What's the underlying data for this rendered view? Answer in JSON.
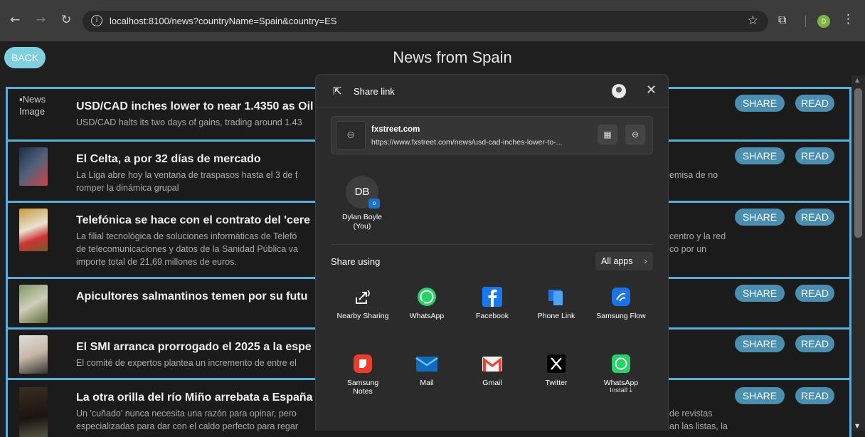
{
  "browser": {
    "url": "localhost:8100/news?countryName=Spain&country=ES",
    "profile_initial": "D"
  },
  "header": {
    "back_label": "BACK",
    "title": "News from Spain"
  },
  "news": [
    {
      "title": "USD/CAD inches lower to near 1.4350 as Oil",
      "desc": "USD/CAD halts its two days of gains, trading around 1.43",
      "desc_right": "",
      "image_alt": "News Image",
      "share_label": "SHARE",
      "read_label": "READ"
    },
    {
      "title": "El Celta, a por 32 días de mercado",
      "desc": "La Liga abre hoy la ventana de traspasos hasta el 3 de f",
      "desc_line2": "romper la dinámica grupal",
      "desc_right": "emisa de no",
      "share_label": "SHARE",
      "read_label": "READ"
    },
    {
      "title": "Telefónica se hace con el contrato del 'cere",
      "desc": "La filial tecnológica de soluciones informáticas de Telefó",
      "desc_line2": "de telecomunicaciones y datos de la Sanidad Pública va",
      "desc_line3": "importe total de 21,69 millones de euros.",
      "desc_right": "centro y la red",
      "desc_right2": "co por un",
      "share_label": "SHARE",
      "read_label": "READ"
    },
    {
      "title": "Apicultores salmantinos temen por su futu",
      "desc": "",
      "share_label": "SHARE",
      "read_label": "READ"
    },
    {
      "title": "El SMI arranca prorrogado el 2025 a la espe",
      "desc": "El comité de expertos plantea un incremento de entre el",
      "share_label": "SHARE",
      "read_label": "READ"
    },
    {
      "title": "La otra orilla del río Miño arrebata a España",
      "desc": "Un 'cuñado' nunca necesita una razón para opinar, pero",
      "desc_line2": "especializadas para dar con el caldo perfecto para regar",
      "desc_right": "de revistas",
      "desc_right2": "an las listas, la",
      "share_label": "SHARE",
      "read_label": "READ"
    }
  ],
  "share_dialog": {
    "heading": "Share link",
    "link_domain": "fxstreet.com",
    "link_url": "https://www.fxstreet.com/news/usd-cad-inches-lower-to-...",
    "contact": {
      "initials": "DB",
      "name_line1": "Dylan Boyle",
      "name_line2": "(You)"
    },
    "share_using_label": "Share using",
    "all_apps_label": "All apps",
    "apps": [
      {
        "label": "Nearby Sharing",
        "icon": "nearby-sharing-icon"
      },
      {
        "label": "WhatsApp",
        "icon": "whatsapp-icon"
      },
      {
        "label": "Facebook",
        "icon": "facebook-icon"
      },
      {
        "label": "Phone Link",
        "icon": "phone-link-icon"
      },
      {
        "label": "Samsung Flow",
        "icon": "samsung-flow-icon"
      },
      {
        "label": "Samsung Notes",
        "icon": "samsung-notes-icon"
      },
      {
        "label": "Mail",
        "icon": "mail-icon"
      },
      {
        "label": "Gmail",
        "icon": "gmail-icon"
      },
      {
        "label": "Twitter",
        "icon": "twitter-x-icon"
      },
      {
        "label": "WhatsApp",
        "sublabel": "Install ⤓",
        "icon": "whatsapp-icon"
      }
    ]
  },
  "colors": {
    "accent_border": "#5aaedc",
    "pill_bg": "#4a8fb0",
    "back_bg": "#7fd0e0"
  }
}
